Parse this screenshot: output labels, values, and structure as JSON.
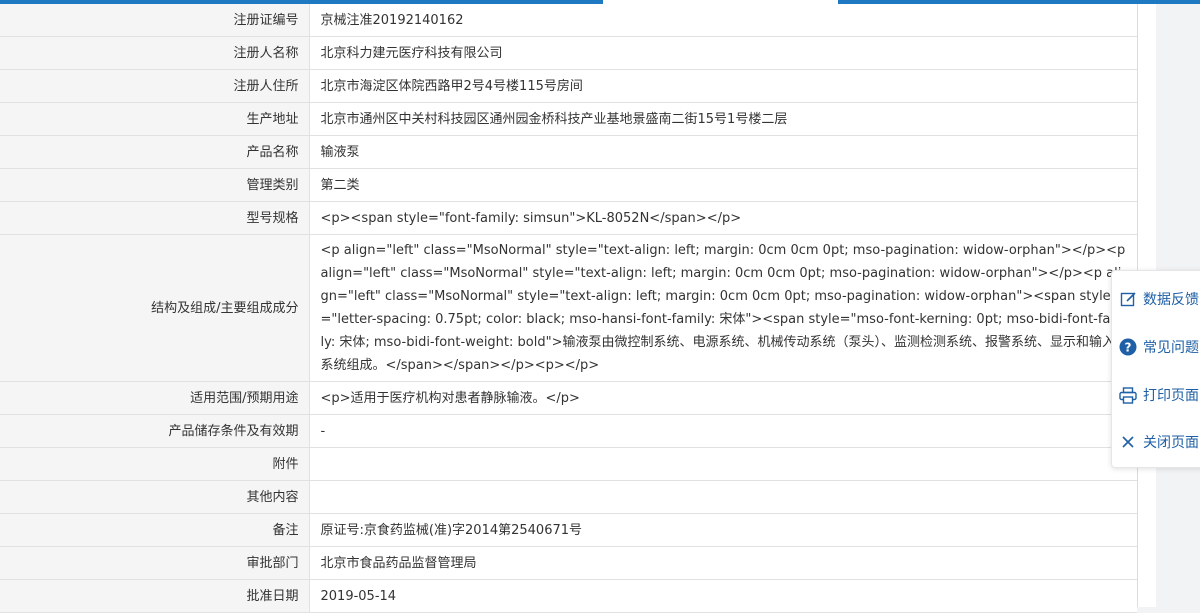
{
  "rows": [
    {
      "label": "注册证编号",
      "value": "京械注准20192140162"
    },
    {
      "label": "注册人名称",
      "value": "北京科力建元医疗科技有限公司"
    },
    {
      "label": "注册人住所",
      "value": "北京市海淀区体院西路甲2号4号楼115号房间"
    },
    {
      "label": "生产地址",
      "value": "北京市通州区中关村科技园区通州园金桥科技产业基地景盛南二街15号1号楼二层"
    },
    {
      "label": "产品名称",
      "value": "输液泵"
    },
    {
      "label": "管理类别",
      "value": "第二类"
    },
    {
      "label": "型号规格",
      "value": "<p><span style=\"font-family: simsun\">KL-8052N</span></p>"
    },
    {
      "label": "结构及组成/主要组成成分",
      "value": "<p align=\"left\" class=\"MsoNormal\" style=\"text-align: left; margin: 0cm 0cm 0pt; mso-pagination: widow-orphan\"></p><p align=\"left\" class=\"MsoNormal\" style=\"text-align: left; margin: 0cm 0cm 0pt; mso-pagination: widow-orphan\"></p><p align=\"left\" class=\"MsoNormal\" style=\"text-align: left; margin: 0cm 0cm 0pt; mso-pagination: widow-orphan\"><span style=\"letter-spacing: 0.75pt; color: black; mso-hansi-font-family: 宋体\"><span style=\"mso-font-kerning: 0pt; mso-bidi-font-family: 宋体; mso-bidi-font-weight: bold\">输液泵由微控制系统、电源系统、机械传动系统（泵头）、监测检测系统、报警系统、显示和输入系统组成。</span></span></p><p></p>"
    },
    {
      "label": "适用范围/预期用途",
      "value": "<p>适用于医疗机构对患者静脉输液。</p>"
    },
    {
      "label": "产品储存条件及有效期",
      "value": "-"
    },
    {
      "label": "附件",
      "value": ""
    },
    {
      "label": "其他内容",
      "value": ""
    },
    {
      "label": "备注",
      "value": "原证号:京食药监械(准)字2014第2540671号"
    },
    {
      "label": "审批部门",
      "value": "北京市食品药品监督管理局"
    },
    {
      "label": "批准日期",
      "value": "2019-05-14"
    }
  ],
  "float_menu": [
    {
      "label": "数据反馈",
      "icon": "edit-icon"
    },
    {
      "label": "常见问题",
      "icon": "help-icon"
    },
    {
      "label": "打印页面",
      "icon": "printer-icon"
    },
    {
      "label": "关闭页面",
      "icon": "close-icon"
    }
  ],
  "colors": {
    "accent": "#1e78c2",
    "link": "#1e5fa5"
  }
}
